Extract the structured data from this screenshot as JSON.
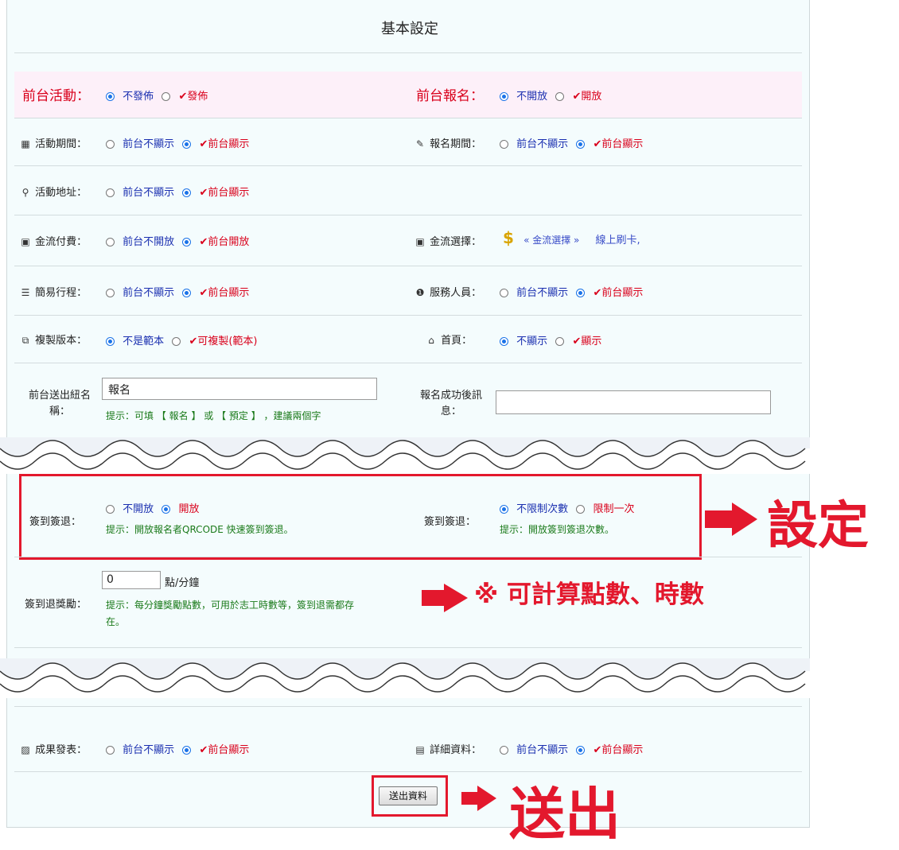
{
  "title": "基本設定",
  "rows": {
    "front_activity": {
      "label": "前台活動：",
      "opt1": "不發佈",
      "opt2": "發佈",
      "selected": 1
    },
    "front_signup": {
      "label": "前台報名：",
      "opt1": "不開放",
      "opt2": "開放",
      "selected": 1
    },
    "activity_period": {
      "label": "活動期間：",
      "opt1": "前台不顯示",
      "opt2": "前台顯示",
      "selected": 2,
      "icon": "calendar-icon"
    },
    "signup_period": {
      "label": "報名期間：",
      "opt1": "前台不顯示",
      "opt2": "前台顯示",
      "selected": 2,
      "icon": "pencil-icon"
    },
    "activity_address": {
      "label": "活動地址：",
      "opt1": "前台不顯示",
      "opt2": "前台顯示",
      "selected": 2,
      "icon": "map-marker-icon"
    },
    "payment": {
      "label": "金流付費：",
      "opt1": "前台不開放",
      "opt2": "前台開放",
      "selected": 2,
      "icon": "money-icon"
    },
    "payment_choice": {
      "label": "金流選擇：",
      "link": "« 金流選擇 »",
      "value": "線上刷卡,",
      "icon": "money-icon"
    },
    "itinerary": {
      "label": "簡易行程：",
      "opt1": "前台不顯示",
      "opt2": "前台顯示",
      "selected": 2,
      "icon": "list-icon"
    },
    "staff": {
      "label": "服務人員：",
      "opt1": "前台不顯示",
      "opt2": "前台顯示",
      "selected": 2,
      "icon": "info-icon"
    },
    "copy_version": {
      "label": "複製版本：",
      "opt1": "不是範本",
      "opt2": "可複製(範本)",
      "selected": 1,
      "icon": "copy-icon"
    },
    "home": {
      "label": "首頁：",
      "opt1": "不顯示",
      "opt2": "顯示",
      "selected": 1,
      "icon": "home-icon"
    },
    "button_name": {
      "label_line1": "前台送出紐名",
      "label_line2": "稱：",
      "value": "報名",
      "hint": "提示：可填 【 報名 】 或 【 預定 】 ，建議兩個字"
    },
    "success_msg": {
      "label_line1": "報名成功後訊",
      "label_line2": "息：",
      "value": ""
    },
    "checkin": {
      "label": "簽到簽退：",
      "opt1": "不開放",
      "opt2": "開放",
      "selected": 2,
      "hint": "提示：開放報名者QRCODE 快速簽到簽退。"
    },
    "checkin_count": {
      "label": "簽到簽退：",
      "opt1": "不限制次數",
      "opt2": "限制一次",
      "selected": 1,
      "hint": "提示：開放簽到簽退次數。"
    },
    "reward": {
      "label": "簽到退獎勵：",
      "value": "0",
      "unit": "點/分鐘",
      "hint_line1": "提示：每分鐘獎勵點數，可用於志工時數等，簽到退需都存",
      "hint_line2": "在。"
    },
    "results": {
      "label": "成果發表：",
      "opt1": "前台不顯示",
      "opt2": "前台顯示",
      "selected": 2,
      "icon": "image-icon"
    },
    "details": {
      "label": "詳細資料：",
      "opt1": "前台不顯示",
      "opt2": "前台顯示",
      "selected": 2,
      "icon": "list-alt-icon"
    }
  },
  "submit_label": "送出資料",
  "annotations": {
    "settings": "設定",
    "calc": "※ 可計算點數、時數",
    "submit": "送出"
  },
  "colors": {
    "accent_red": "#e3182d",
    "pink_row": "#fdf0f9",
    "panel_bg": "#f4fcfd",
    "radio_blue": "#1a73e8"
  }
}
